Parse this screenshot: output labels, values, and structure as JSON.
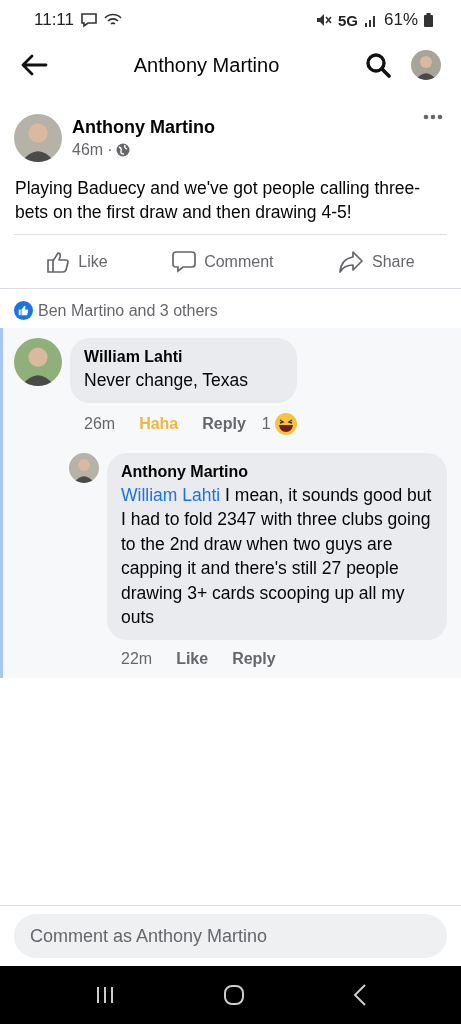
{
  "status_bar": {
    "time": "11:11",
    "network": "5G",
    "battery": "61%"
  },
  "header": {
    "title": "Anthony Martino"
  },
  "post": {
    "author": "Anthony Martino",
    "time": "46m",
    "separator": "·",
    "text": "Playing Baduecy and we've got people calling three-bets on the first draw and then drawing 4-5!",
    "actions": [
      {
        "kind": "like",
        "label": "Like"
      },
      {
        "kind": "comment",
        "label": "Comment"
      },
      {
        "kind": "share",
        "label": "Share"
      }
    ],
    "likes": "Ben Martino and 3 others"
  },
  "comments": [
    {
      "author": "William Lahti",
      "text": "Never change, Texas",
      "time": "26m",
      "reaction_label": "Haha",
      "reacted": true,
      "reply_label": "Reply",
      "reaction_count": "1",
      "replies": [
        {
          "author": "Anthony Martino",
          "mention": "William Lahti",
          "text": "I mean, it sounds good but I had to fold 2347 with three clubs going to the 2nd draw when two guys are capping it and there's still 27 people drawing 3+ cards scooping up all my outs",
          "time": "22m",
          "reaction_label": "Like",
          "reacted": false,
          "reply_label": "Reply"
        }
      ]
    }
  ],
  "composer": {
    "placeholder": "Comment as Anthony Martino"
  }
}
